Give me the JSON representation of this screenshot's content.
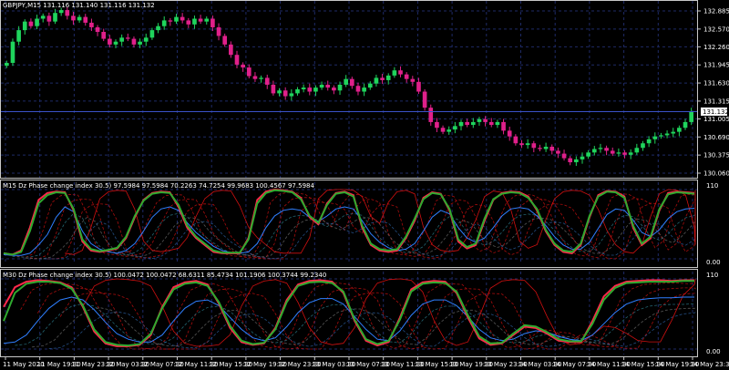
{
  "colors": {
    "background": "#000000",
    "grid": "#1e2a66",
    "axis": "#c8c8c8",
    "bull": "#1fd45c",
    "bear": "#e0208a",
    "red": "#ff2a4a",
    "green": "#2faa2f",
    "darkred": "#d01010",
    "blue": "#2f7fff"
  },
  "main": {
    "header": "GBPJPY,M15  131.116 131.140 131.116 131.132",
    "price_labels": [
      "132.885",
      "132.570",
      "132.260",
      "131.945",
      "131.630",
      "131.315",
      "131.005",
      "130.690",
      "130.375",
      "130.060"
    ],
    "current_price": "131.132",
    "price_min": 130.06,
    "price_max": 132.885,
    "closes": [
      131.98,
      132.35,
      132.55,
      132.7,
      132.62,
      132.75,
      132.8,
      132.7,
      132.85,
      132.9,
      132.8,
      132.72,
      132.78,
      132.68,
      132.6,
      132.52,
      132.4,
      132.3,
      132.35,
      132.42,
      132.4,
      132.3,
      132.35,
      132.42,
      132.55,
      132.62,
      132.72,
      132.7,
      132.78,
      132.72,
      132.65,
      132.75,
      132.7,
      132.75,
      132.6,
      132.45,
      132.3,
      132.12,
      131.95,
      131.9,
      131.75,
      131.7,
      131.72,
      131.6,
      131.45,
      131.5,
      131.4,
      131.45,
      131.52,
      131.55,
      131.48,
      131.55,
      131.6,
      131.55,
      131.5,
      131.6,
      131.7,
      131.58,
      131.48,
      131.55,
      131.62,
      131.72,
      131.68,
      131.76,
      131.85,
      131.78,
      131.7,
      131.65,
      131.48,
      131.2,
      130.95,
      130.85,
      130.78,
      130.82,
      130.88,
      130.95,
      130.9,
      130.95,
      131.0,
      130.95,
      130.9,
      130.95,
      130.8,
      130.7,
      130.58,
      130.55,
      130.58,
      130.5,
      130.48,
      130.52,
      130.45,
      130.4,
      130.32,
      130.25,
      130.3,
      130.35,
      130.42,
      130.48,
      130.5,
      130.45,
      130.4,
      130.42,
      130.38,
      130.42,
      130.5,
      130.58,
      130.65,
      130.7,
      130.72,
      130.75,
      130.78,
      130.85,
      130.95,
      131.13
    ]
  },
  "ind1": {
    "header": "M15 Dz Phase change index 30.5) 97.5984 97.5984 70.2263 74.7254 99.9683 100.4567 97.5984",
    "level_high": "110",
    "level_low": "0.00",
    "red_line": [
      8,
      6,
      12,
      45,
      85,
      95,
      97,
      96,
      70,
      25,
      12,
      10,
      12,
      15,
      30,
      60,
      85,
      95,
      97,
      96,
      75,
      45,
      30,
      20,
      10,
      8,
      8,
      8,
      30,
      85,
      97,
      100,
      99,
      97,
      88,
      60,
      50,
      80,
      95,
      97,
      92,
      45,
      20,
      12,
      10,
      12,
      30,
      55,
      88,
      96,
      94,
      70,
      25,
      15,
      20,
      55,
      85,
      95,
      97,
      96,
      90,
      70,
      40,
      20,
      10,
      8,
      20,
      60,
      92,
      98,
      97,
      90,
      45,
      20,
      30,
      70,
      95,
      97,
      96,
      95
    ],
    "green_line": [
      8,
      6,
      10,
      40,
      80,
      92,
      96,
      95,
      72,
      28,
      14,
      11,
      13,
      16,
      32,
      62,
      84,
      94,
      96,
      95,
      78,
      48,
      32,
      22,
      12,
      9,
      9,
      9,
      28,
      80,
      95,
      99,
      98,
      96,
      86,
      62,
      52,
      78,
      94,
      96,
      90,
      48,
      22,
      14,
      12,
      14,
      32,
      58,
      86,
      95,
      93,
      72,
      28,
      17,
      22,
      58,
      86,
      94,
      96,
      95,
      88,
      72,
      42,
      22,
      12,
      10,
      22,
      62,
      90,
      97,
      96,
      88,
      48,
      22,
      32,
      72,
      93,
      96,
      95,
      94
    ],
    "blue_line": [
      6,
      5,
      5,
      8,
      20,
      35,
      60,
      75,
      68,
      40,
      22,
      14,
      10,
      8,
      12,
      22,
      40,
      60,
      72,
      75,
      70,
      52,
      38,
      28,
      18,
      12,
      9,
      8,
      10,
      22,
      45,
      62,
      70,
      72,
      70,
      60,
      54,
      62,
      72,
      75,
      72,
      55,
      36,
      24,
      16,
      12,
      14,
      22,
      40,
      60,
      70,
      65,
      45,
      30,
      24,
      30,
      45,
      62,
      72,
      74,
      72,
      62,
      48,
      32,
      20,
      14,
      14,
      24,
      44,
      64,
      72,
      70,
      56,
      38,
      32,
      42,
      58,
      68,
      72,
      73
    ]
  },
  "ind2": {
    "header": "M30 Dz Phase change index 30.5) 100.0472 100.0472 68.6311 85.4734 101.1906 100.3744 99.2340",
    "level_high": "110",
    "level_low": "0.00",
    "red_line": [
      60,
      88,
      96,
      98,
      97,
      95,
      88,
      60,
      25,
      8,
      4,
      4,
      6,
      20,
      60,
      88,
      95,
      97,
      92,
      65,
      30,
      10,
      6,
      8,
      30,
      70,
      92,
      97,
      98,
      96,
      80,
      40,
      12,
      5,
      10,
      45,
      85,
      95,
      97,
      96,
      80,
      45,
      15,
      6,
      8,
      20,
      32,
      30,
      22,
      12,
      10,
      10,
      40,
      75,
      90,
      96,
      97,
      98,
      98,
      97,
      98,
      98
    ],
    "green_line": [
      40,
      80,
      93,
      96,
      96,
      94,
      86,
      62,
      28,
      10,
      6,
      5,
      7,
      22,
      58,
      85,
      93,
      95,
      90,
      67,
      33,
      12,
      7,
      9,
      28,
      67,
      90,
      95,
      96,
      94,
      82,
      42,
      14,
      7,
      12,
      42,
      82,
      93,
      95,
      94,
      82,
      48,
      18,
      8,
      9,
      22,
      34,
      32,
      24,
      14,
      11,
      11,
      36,
      70,
      87,
      94,
      95,
      96,
      96,
      96,
      97,
      97
    ],
    "blue_line": [
      8,
      10,
      20,
      40,
      58,
      70,
      74,
      70,
      56,
      38,
      22,
      14,
      10,
      10,
      20,
      40,
      58,
      68,
      70,
      62,
      45,
      28,
      16,
      12,
      16,
      32,
      52,
      66,
      72,
      72,
      64,
      46,
      28,
      14,
      12,
      26,
      48,
      64,
      70,
      70,
      62,
      46,
      28,
      16,
      12,
      14,
      22,
      26,
      24,
      18,
      14,
      12,
      20,
      36,
      52,
      64,
      70,
      72,
      73,
      73,
      74,
      74
    ]
  },
  "time_labels": [
    "11 May 2020",
    "11 May 19:30",
    "11 May 23:30",
    "12 May 03:30",
    "12 May 07:30",
    "12 May 11:30",
    "12 May 15:30",
    "12 May 19:30",
    "12 May 23:30",
    "13 May 03:30",
    "13 May 07:30",
    "13 May 11:30",
    "13 May 15:30",
    "13 May 19:30",
    "13 May 23:30",
    "14 May 03:30",
    "14 May 07:30",
    "14 May 11:30",
    "14 May 15:30",
    "14 May 19:30",
    "14 May 23:30"
  ]
}
